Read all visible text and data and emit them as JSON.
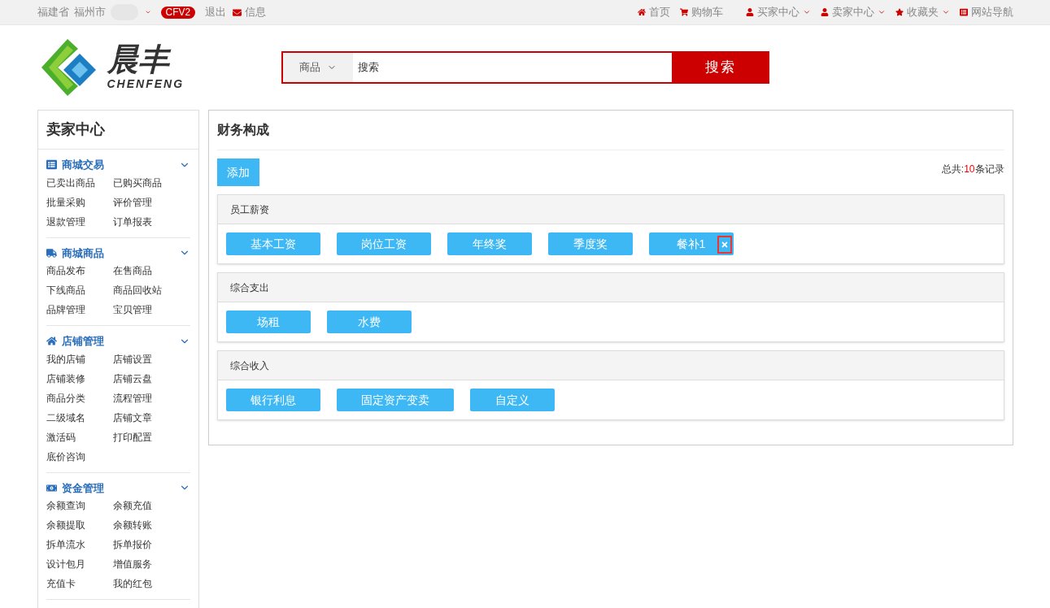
{
  "topbar": {
    "location": [
      "福建省",
      "福州市"
    ],
    "badge": "CFV2",
    "logout": "退出",
    "messages": "信息",
    "right_links": [
      {
        "label": "首页",
        "dropdown": false
      },
      {
        "label": "购物车",
        "dropdown": false
      },
      {
        "label": "买家中心",
        "dropdown": true
      },
      {
        "label": "卖家中心",
        "dropdown": true
      },
      {
        "label": "收藏夹",
        "dropdown": true
      },
      {
        "label": "网站导航",
        "dropdown": false
      }
    ]
  },
  "header": {
    "logo_text": "晨丰",
    "logo_subtext": "CHENFENG",
    "search": {
      "category": "商品",
      "placeholder": "搜索",
      "button": "搜索"
    }
  },
  "sidebar": {
    "title": "卖家中心",
    "sections": [
      {
        "title": "商城交易",
        "expanded": true,
        "items": [
          "已卖出商品",
          "已购买商品",
          "批量采购",
          "评价管理",
          "退款管理",
          "订单报表"
        ]
      },
      {
        "title": "商城商品",
        "expanded": true,
        "items": [
          "商品发布",
          "在售商品",
          "下线商品",
          "商品回收站",
          "品牌管理",
          "宝贝管理"
        ]
      },
      {
        "title": "店铺管理",
        "expanded": true,
        "items": [
          "我的店铺",
          "店铺设置",
          "店铺装修",
          "店铺云盘",
          "商品分类",
          "流程管理",
          "二级域名",
          "店铺文章",
          "激活码",
          "打印配置",
          "底价咨询"
        ]
      },
      {
        "title": "资金管理",
        "expanded": true,
        "items": [
          "余额查询",
          "余额充值",
          "余额提取",
          "余额转账",
          "拆单流水",
          "拆单报价",
          "设计包月",
          "增值服务",
          "充值卡",
          "我的红包"
        ]
      }
    ]
  },
  "main": {
    "title": "财务构成",
    "add_button": "添加",
    "total": {
      "prefix": "总共:",
      "count": "10",
      "suffix": "条记录"
    },
    "groups": [
      {
        "title": "员工薪资",
        "tags": [
          {
            "label": "基本工资",
            "show_delete": false
          },
          {
            "label": "岗位工资",
            "show_delete": false
          },
          {
            "label": "年终奖",
            "show_delete": false
          },
          {
            "label": "季度奖",
            "show_delete": false
          },
          {
            "label": "餐补1",
            "show_delete": true
          }
        ]
      },
      {
        "title": "综合支出",
        "tags": [
          {
            "label": "场租",
            "show_delete": false
          },
          {
            "label": "水费",
            "show_delete": false
          }
        ]
      },
      {
        "title": "综合收入",
        "tags": [
          {
            "label": "银行利息",
            "show_delete": false
          },
          {
            "label": "固定资产变卖",
            "show_delete": false
          },
          {
            "label": "自定义",
            "show_delete": false
          }
        ]
      }
    ]
  }
}
